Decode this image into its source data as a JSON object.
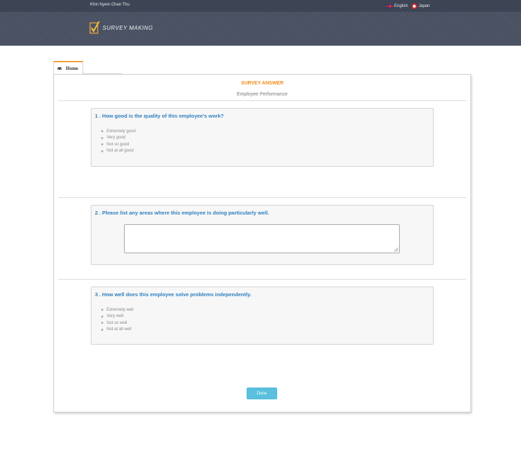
{
  "header": {
    "username": "Khin Nyein Chan Thu",
    "languages": [
      {
        "label": "English",
        "icon": "uk-flag-icon"
      },
      {
        "label": "Japan",
        "icon": "japan-flag-icon"
      }
    ],
    "logo_text": "SURVEY MAKING",
    "background_color": "#4a5263"
  },
  "tabs": [
    {
      "label": "Home",
      "icon": "car-icon",
      "active": true
    }
  ],
  "survey": {
    "title": "SURVEY ANSWER",
    "subtitle": "Employee Performance",
    "questions": [
      {
        "title": "1 . How good is the quality of this employee's work?",
        "type": "options",
        "options": [
          "Extremely good",
          "Very good",
          "Not so good",
          "Not at all good"
        ]
      },
      {
        "title": "2 . Please list any areas where this employee is doing particularly well.",
        "type": "text",
        "value": ""
      },
      {
        "title": "3 . How well does this employee solve problems independently.",
        "type": "options",
        "options": [
          "Extremely well",
          "Very well",
          "Not so well",
          "Not at all well"
        ]
      }
    ],
    "done_label": "Done"
  },
  "colors": {
    "accent_orange": "#f08c1a",
    "question_blue": "#2d7fc0",
    "button": "#5bc0de"
  }
}
